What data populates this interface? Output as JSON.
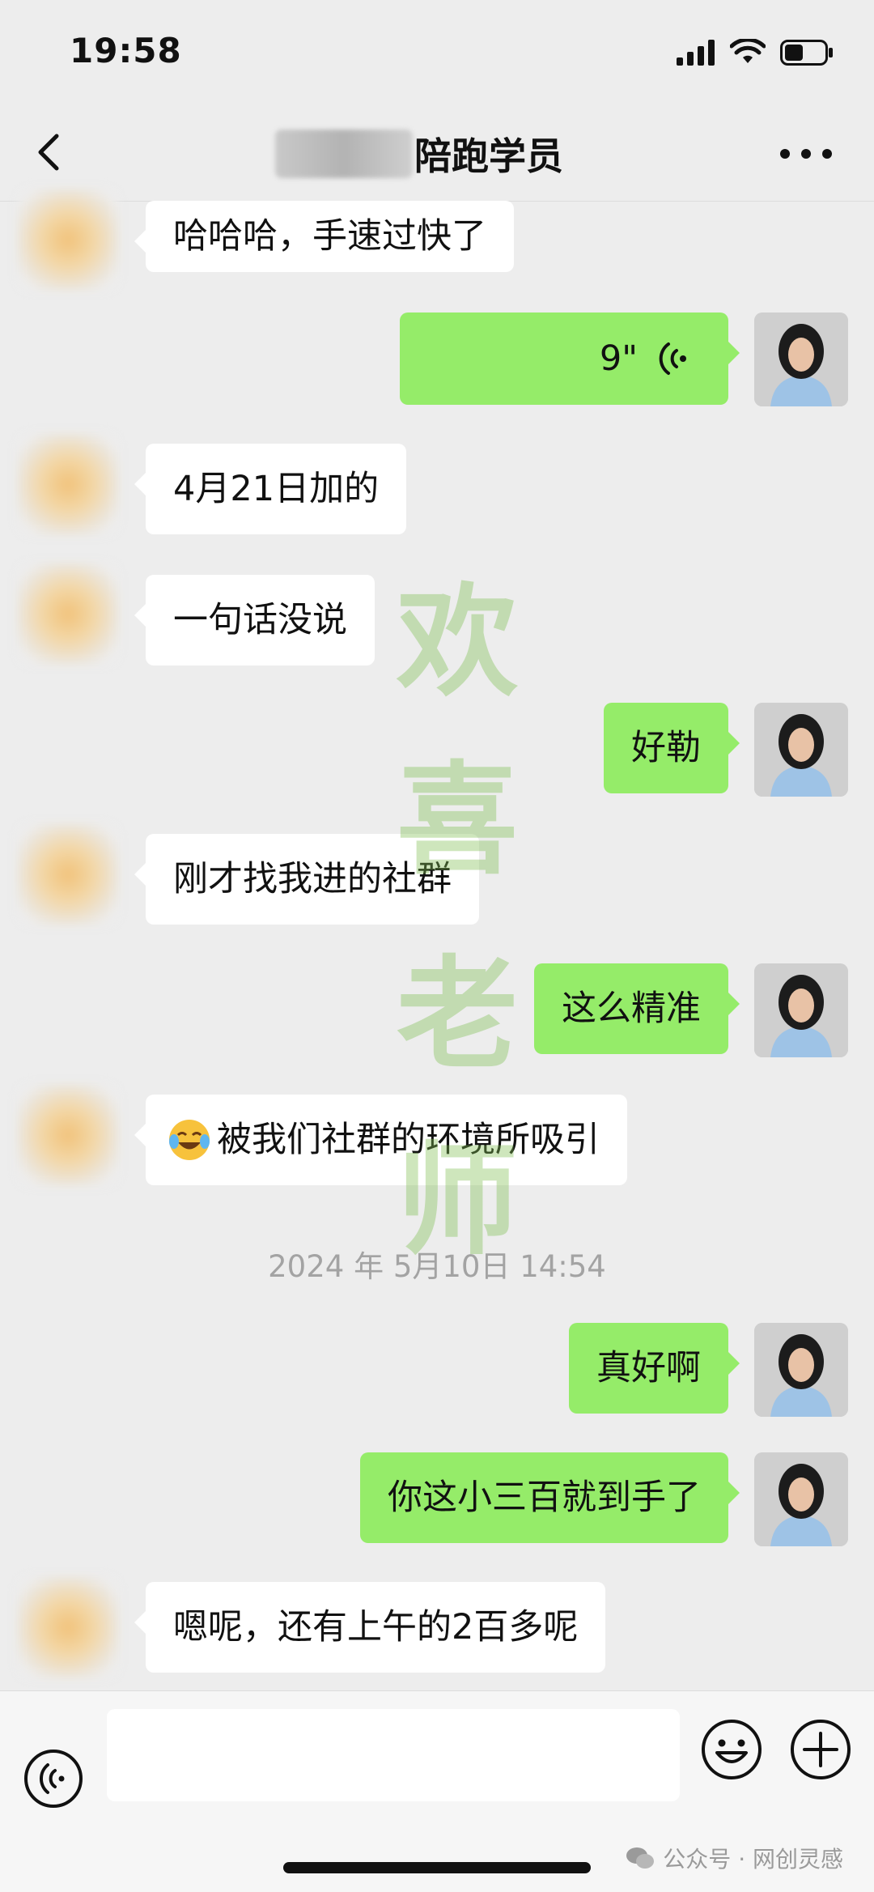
{
  "status_bar": {
    "time": "19:58",
    "battery_level": 0.45
  },
  "nav": {
    "title_visible": "陪跑学员",
    "back_icon": "chevron-left-icon",
    "more_icon": "more-dots-icon"
  },
  "messages": [
    {
      "side": "in",
      "text": "哈哈哈，手速过快了"
    },
    {
      "side": "out",
      "type": "voice",
      "duration": "9\""
    },
    {
      "side": "in",
      "text": "4月21日加的"
    },
    {
      "side": "in",
      "text": "一句话没说"
    },
    {
      "side": "out",
      "text": "好勒"
    },
    {
      "side": "in",
      "text": "刚才找我进的社群"
    },
    {
      "side": "out",
      "text": "这么精准"
    },
    {
      "side": "in",
      "text": "被我们社群的环境所吸引",
      "emoji": "laughing-crying-emoji"
    },
    {
      "type": "timestamp",
      "text": "2024 年 5月10日 14:54"
    },
    {
      "side": "out",
      "text": "真好啊"
    },
    {
      "side": "out",
      "text": "你这小三百就到手了"
    },
    {
      "side": "in",
      "text": "嗯呢，还有上午的2百多呢"
    }
  ],
  "watermark": {
    "chars": [
      "欢",
      "喜",
      "老",
      "师"
    ]
  },
  "input_bar": {
    "placeholder": "",
    "voice_icon": "voice-icon",
    "emoji_icon": "emoji-icon",
    "plus_icon": "plus-icon"
  },
  "footer": {
    "text": "公众号 · 网创灵感"
  },
  "colors": {
    "background": "#ededed",
    "outgoing_bubble": "#95ec69",
    "incoming_bubble": "#ffffff",
    "timestamp": "#a3a3a3"
  }
}
